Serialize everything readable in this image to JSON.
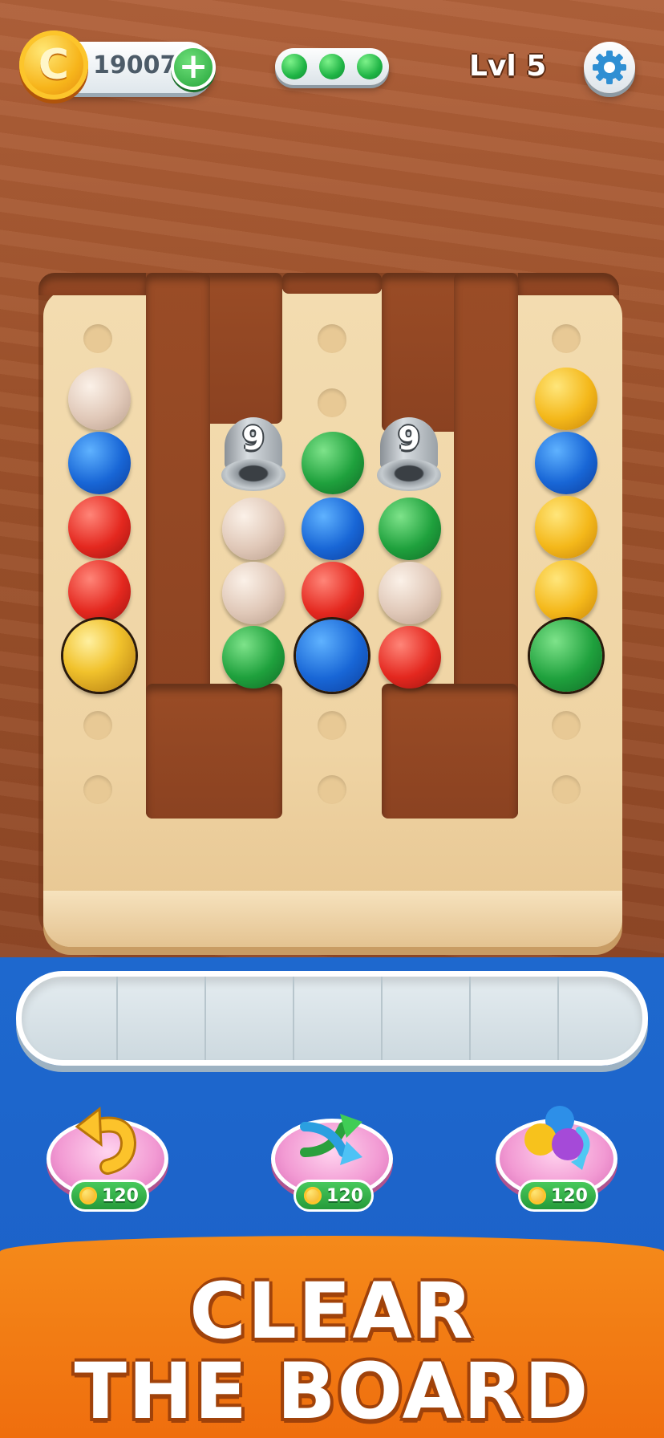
{
  "header": {
    "coin_symbol": "C",
    "coins": "19007",
    "add_coins_label": "+",
    "level": "Lvl 5",
    "progress_dots": 3,
    "settings_icon": "gear-icon"
  },
  "board": {
    "columns": [
      {
        "name": "column-1",
        "balls": [
          "beige",
          "blue",
          "red",
          "red",
          "gold-highlighted"
        ]
      },
      {
        "name": "column-2",
        "lock": "9",
        "balls": [
          "beige",
          "beige",
          "green"
        ]
      },
      {
        "name": "column-3",
        "balls": [
          "green",
          "blue",
          "red",
          "blue-highlighted"
        ]
      },
      {
        "name": "column-4",
        "lock": "9",
        "balls": [
          "green",
          "beige",
          "red"
        ]
      },
      {
        "name": "column-5",
        "balls": [
          "yellow",
          "blue",
          "yellow",
          "yellow",
          "green-highlighted"
        ]
      }
    ],
    "colors": {
      "beige": "#e0c8b8",
      "blue": "#1866d6",
      "red": "#e4281f",
      "green": "#1fa13d",
      "yellow": "#f4b81a",
      "board": "#f3dcb0",
      "wood": "#9e522b"
    }
  },
  "tray": {
    "slots": 7
  },
  "boosters": [
    {
      "name": "undo",
      "icon": "undo-arrow-icon",
      "price": "120"
    },
    {
      "name": "shuffle",
      "icon": "shuffle-icon",
      "price": "120"
    },
    {
      "name": "swap-colors",
      "icon": "color-swap-icon",
      "price": "120"
    }
  ],
  "banner": {
    "line1": "CLEAR",
    "line2": "THE BOARD"
  }
}
